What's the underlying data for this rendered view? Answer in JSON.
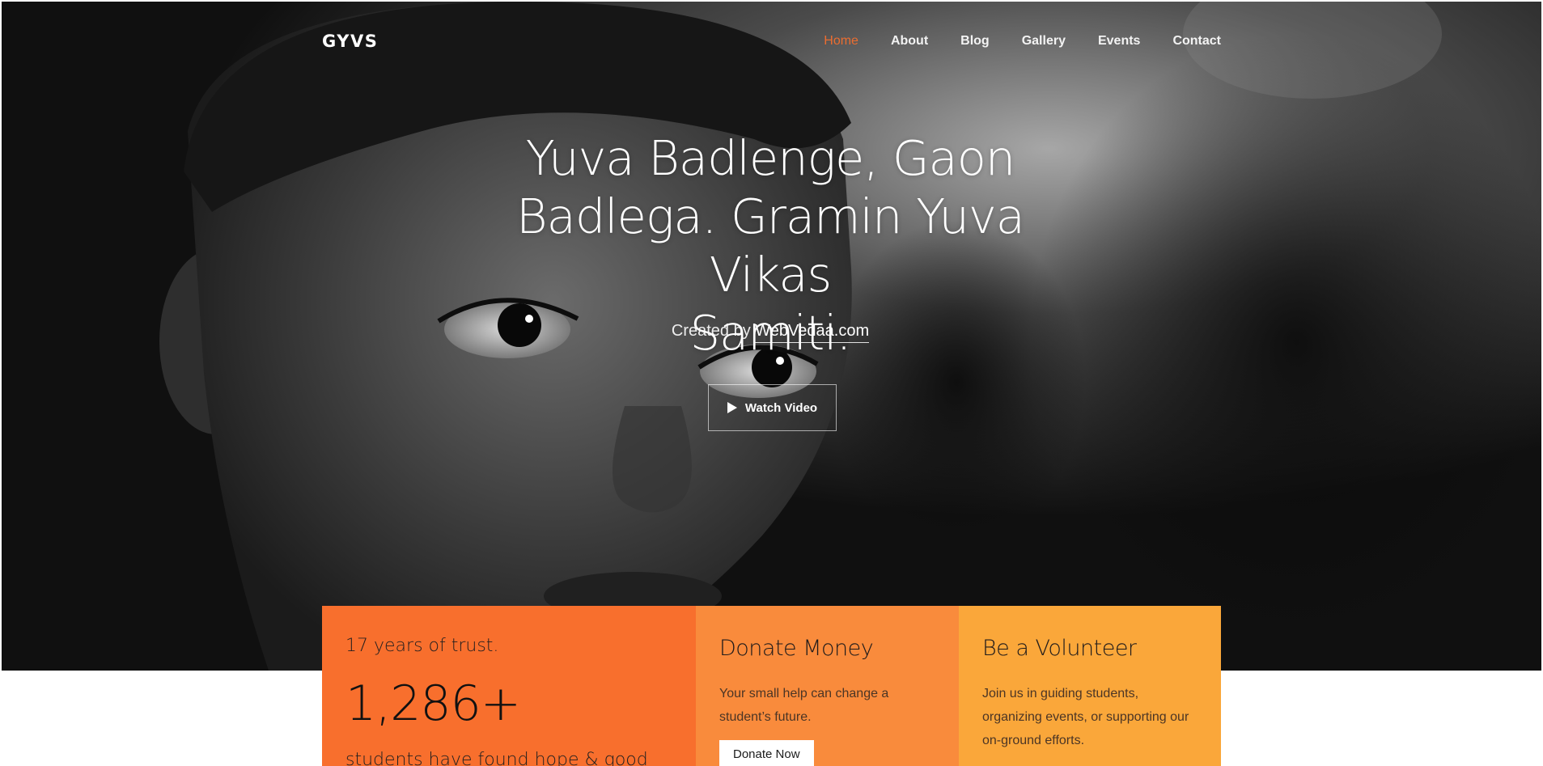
{
  "brand": "GYVS",
  "nav": {
    "items": [
      {
        "label": "Home",
        "active": true
      },
      {
        "label": "About",
        "active": false
      },
      {
        "label": "Blog",
        "active": false
      },
      {
        "label": "Gallery",
        "active": false
      },
      {
        "label": "Events",
        "active": false
      },
      {
        "label": "Contact",
        "active": false
      }
    ]
  },
  "hero": {
    "title_lines": [
      "Yuva Badlenge, Gaon",
      "Badlega. Gramin Yuva Vikas",
      "Samiti."
    ],
    "credit_prefix": "Created by",
    "credit_link": "WebVedaa.com",
    "watch_label": "Watch Video"
  },
  "cards": {
    "trust": {
      "title": "17 years of trust.",
      "count": "1,286+",
      "partial_text": "students have found hope & good"
    },
    "donate": {
      "title": "Donate Money",
      "text": "Your small help can change a student’s future.",
      "button": "Donate Now"
    },
    "volunteer": {
      "title": "Be a Volunteer",
      "text": "Join us in guiding students, organizing events, or supporting our on-ground efforts."
    }
  },
  "colors": {
    "accent": "#f86f2d",
    "card_donate": "#f98b3c",
    "card_volunteer": "#faa73a"
  }
}
